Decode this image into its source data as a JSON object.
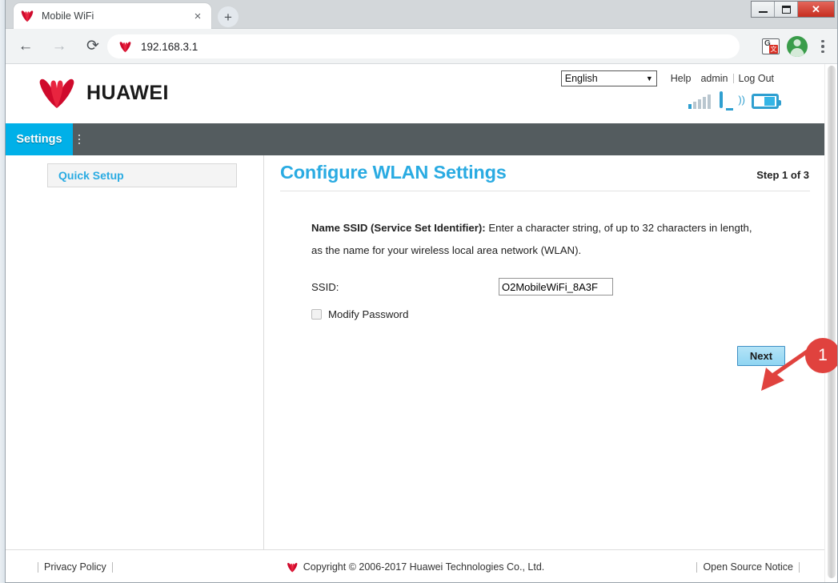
{
  "browser": {
    "tab": {
      "title": "Mobile WiFi",
      "favicon": "huawei-favicon",
      "close_label": "×"
    },
    "new_tab_label": "+",
    "window_controls": {
      "minimize": "minimize-icon",
      "maximize": "restore-icon",
      "close": "✕"
    },
    "nav": {
      "back": "←",
      "forward": "→",
      "reload": "⟳"
    },
    "address_bar": {
      "url": "192.168.3.1",
      "favicon": "huawei-favicon"
    },
    "toolbar_right": {
      "translate": "translate-icon",
      "translate_letter": "G",
      "translate_badge": "文",
      "avatar": "profile-avatar",
      "menu": "three-dot-menu"
    }
  },
  "router_page": {
    "logo_text": "HUAWEI",
    "language": {
      "selected": "English",
      "arrow": "▼"
    },
    "top_links": [
      {
        "label": "Help"
      },
      {
        "label": "admin"
      },
      {
        "label": "Log Out"
      }
    ],
    "status_icons": {
      "signal": {
        "name": "signal-bars",
        "bars_total": 5,
        "bars_active": 1
      },
      "wifi_monitor": {
        "name": "wifi-monitor-icon",
        "waves": ")))"
      },
      "battery": {
        "name": "battery-icon"
      }
    },
    "nav_tabs": [
      {
        "label": "Settings",
        "active": true
      }
    ],
    "sidebar": {
      "items": [
        {
          "label": "Quick Setup",
          "active": true
        }
      ]
    },
    "content": {
      "title": "Configure WLAN Settings",
      "step": "Step 1 of 3",
      "description_bold": "Name SSID (Service Set Identifier):",
      "description_text": "Enter a character string, of up to 32 characters in length, as the name for your wireless local area network (WLAN).",
      "ssid_label": "SSID:",
      "ssid_value": "O2MobileWiFi_8A3F",
      "modify_password_label": "Modify Password",
      "modify_password_checked": false,
      "next_button": "Next"
    },
    "footer": {
      "privacy_policy": "Privacy Policy",
      "copyright": "Copyright © 2006-2017 Huawei Technologies Co., Ltd.",
      "open_source_notice": "Open Source Notice"
    }
  },
  "annotation": {
    "badge_number": "1",
    "badge_color": "#e0423e",
    "arrow_color": "#e0423e"
  },
  "colors": {
    "brand_cyan": "#2aabe2",
    "nav_active": "#00b0e8",
    "nav_bar": "#545c5f",
    "huawei_red": "#cf0a2c"
  }
}
